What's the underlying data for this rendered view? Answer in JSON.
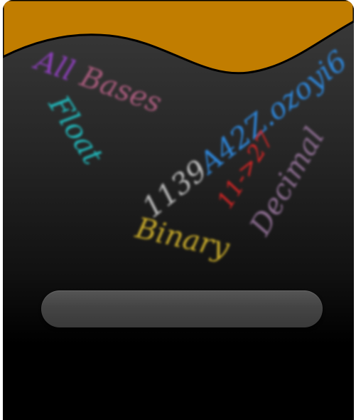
{
  "app": {
    "words": {
      "all_bases_prefix": "All",
      "all_bases_suffix": " Bases",
      "float": "Float",
      "number_prefix": "1139",
      "number_rest": "A42Z.ozoyi6",
      "conversion": "11->27",
      "decimal": "Decimal",
      "binary": "Binary"
    },
    "colors": {
      "banner": "#c17d00",
      "all_bases": "#a55a7a",
      "float": "#21b5b8",
      "number": "#2d84d6",
      "conversion": "#d62525",
      "decimal": "#8a6b8e",
      "binary": "#c4a72a"
    },
    "input": {
      "value": ""
    }
  }
}
